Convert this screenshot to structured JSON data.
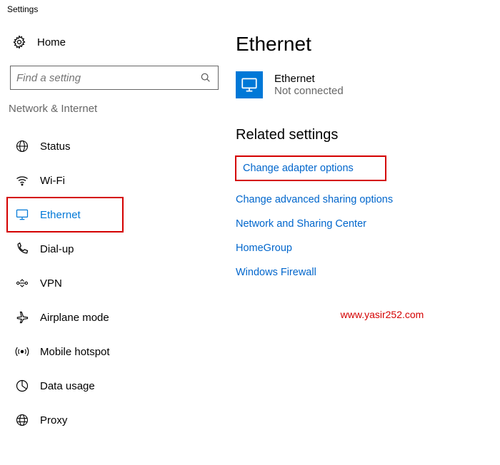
{
  "window": {
    "title": "Settings"
  },
  "sidebar": {
    "home_label": "Home",
    "search_placeholder": "Find a setting",
    "category_label": "Network & Internet",
    "items": [
      {
        "label": "Status"
      },
      {
        "label": "Wi-Fi"
      },
      {
        "label": "Ethernet"
      },
      {
        "label": "Dial-up"
      },
      {
        "label": "VPN"
      },
      {
        "label": "Airplane mode"
      },
      {
        "label": "Mobile hotspot"
      },
      {
        "label": "Data usage"
      },
      {
        "label": "Proxy"
      }
    ]
  },
  "main": {
    "heading": "Ethernet",
    "ethernet_card": {
      "title": "Ethernet",
      "status": "Not connected"
    },
    "related_heading": "Related settings",
    "links": [
      {
        "label": "Change adapter options"
      },
      {
        "label": "Change advanced sharing options"
      },
      {
        "label": "Network and Sharing Center"
      },
      {
        "label": "HomeGroup"
      },
      {
        "label": "Windows Firewall"
      }
    ]
  },
  "watermark": "www.yasir252.com"
}
